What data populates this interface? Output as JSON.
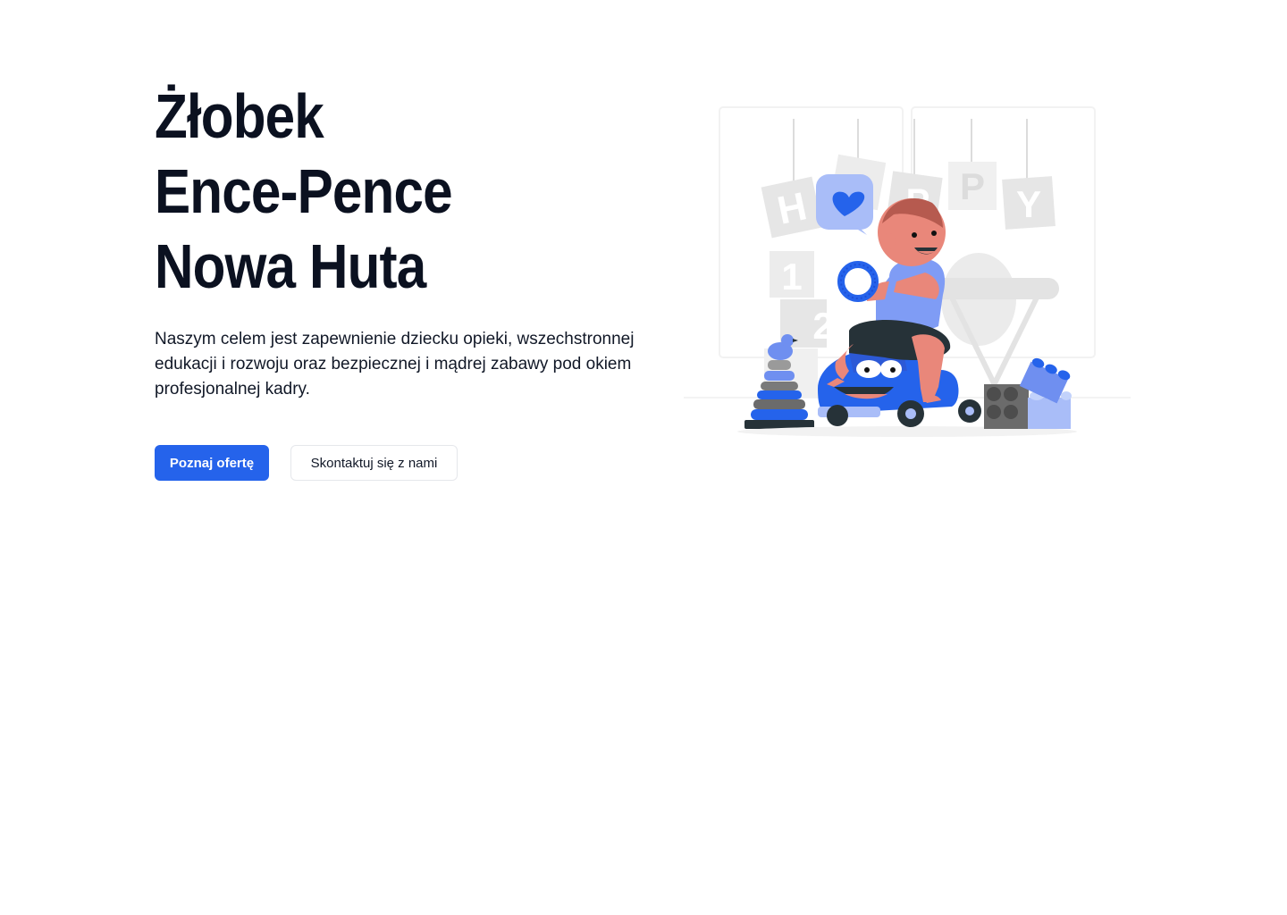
{
  "hero": {
    "title_lines": [
      "Żłobek",
      "Ence-Pence",
      "Nowa Huta"
    ],
    "description": "Naszym celem jest zapewnienie dziecku opieki, wszechstronnej edukacji i rozwoju oraz bezpiecznej i mądrej zabawy pod okiem profesjonalnej kadry.",
    "primary_button": "Poznaj ofertę",
    "secondary_button": "Skontaktuj się z nami"
  },
  "illustration": {
    "icon": "baby-on-toy-car-illustration",
    "banner_letters": [
      "H",
      "A",
      "P",
      "P",
      "Y"
    ],
    "block_numbers": [
      "1",
      "2"
    ],
    "colors": {
      "accent": "#2563eb",
      "light_accent": "#a9bdf8",
      "grey": "#e6e6e6",
      "skin": "#e9877a"
    }
  },
  "colors": {
    "primary": "#2563eb",
    "text": "#0b1120"
  }
}
